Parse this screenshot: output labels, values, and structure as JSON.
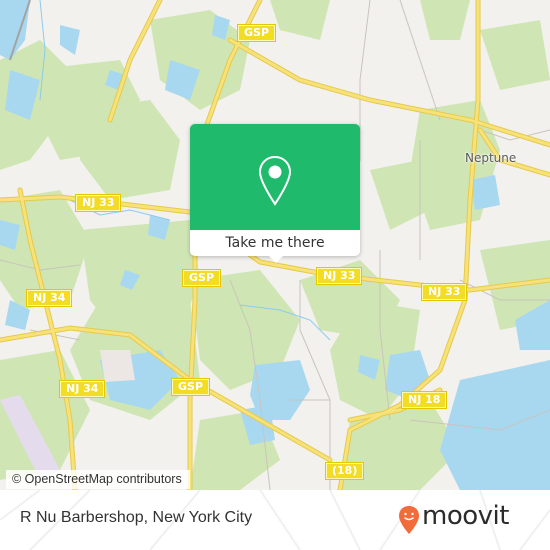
{
  "map": {
    "colors": {
      "land": "#f2f1ee",
      "park": "#cfe6b4",
      "water": "#a8d8f0",
      "road_major": "#f5dc5a",
      "road_minor": "#c9c4bd",
      "shield_bg": "#f2dc25"
    },
    "shields": [
      {
        "id": "gsp-top",
        "label": "GSP"
      },
      {
        "id": "nj33-left",
        "label": "NJ 33"
      },
      {
        "id": "nj33-mid",
        "label": "NJ 33"
      },
      {
        "id": "nj33-right",
        "label": "NJ 33"
      },
      {
        "id": "gsp-mid",
        "label": "GSP"
      },
      {
        "id": "nj34-upper",
        "label": "NJ 34"
      },
      {
        "id": "nj34-lower",
        "label": "NJ 34"
      },
      {
        "id": "gsp-lower",
        "label": "GSP"
      },
      {
        "id": "nj18",
        "label": "NJ 18"
      },
      {
        "id": "rt18",
        "label": "(18)"
      }
    ],
    "place_labels": [
      {
        "id": "neptune",
        "label": "Neptune"
      }
    ],
    "attribution": "© OpenStreetMap contributors"
  },
  "popup": {
    "icon": "map-pin-icon",
    "accent_color": "#1fba6b",
    "cta_label": "Take me there"
  },
  "footer": {
    "place_title": "R Nu Barbershop, New York City",
    "brand": {
      "name": "moovit",
      "logo_color": "#f26b3a"
    }
  }
}
